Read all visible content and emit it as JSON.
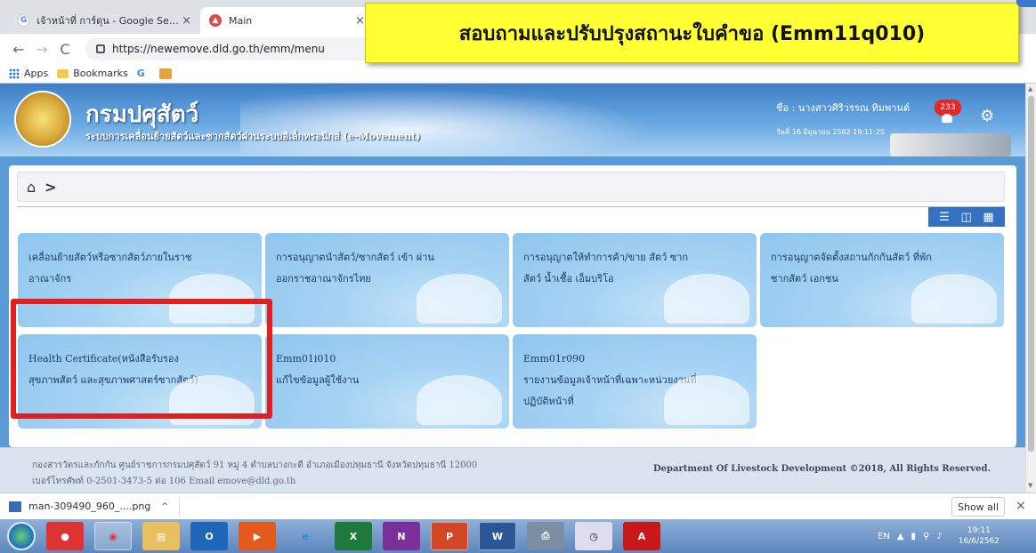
{
  "browser": {
    "tabs": [
      {
        "label": "เจ้าหน้าที่ การ์ดุน - Google Search",
        "icon": "google-icon",
        "close": "×"
      },
      {
        "label": "Main",
        "icon": "dld-favicon",
        "close": "×"
      }
    ],
    "url": "https://newemove.dld.go.th/emm/menu",
    "bookmarks": [
      {
        "label": "Apps",
        "icon": "apps-grid-icon"
      },
      {
        "label": "Bookmarks",
        "icon": "folder-icon"
      },
      {
        "label": "",
        "icon": "google-icon"
      },
      {
        "label": "",
        "icon": "image-bookmark-icon"
      }
    ]
  },
  "banner": {
    "text": "สอบถามและปรับปรุงสถานะใบคำขอ (Emm11q010)",
    "bg": "#ffff33"
  },
  "header": {
    "logo_title": "กรมปศุสัตว์",
    "logo_subtitle": "ระบบการเคลื่อนย้ายสัตว์และซากสัตว์ผ่านระบบอิเล็กทรอนิกส์ (e-Movement)",
    "user_name": "ชื่อ : นางสาวศิริวรรณ ทิมพานต์",
    "user_date": "วันที่ 16 มิถุนายน 2562 19:11:25",
    "notification_count": "233"
  },
  "breadcrumb": {
    "home_icon": "home-icon",
    "arrow": ">"
  },
  "view_toggles": [
    "list-view-icon",
    "split-view-icon",
    "grid-view-icon"
  ],
  "tiles": [
    {
      "lines": [
        "เคลื่อนย้ายสัตว์หรือซากสัตว์ภายในราช",
        "อาณาจักร"
      ],
      "icon": "truck-icon"
    },
    {
      "lines": [
        "การอนุญาตนำสัตว์/ซากสัตว์ เข้า ผ่าน",
        "ออกราชอาณาจักรไทย"
      ],
      "icon": "map-plane-ship-icon"
    },
    {
      "lines": [
        "การอนุญาตให้ทำการค้า/ขาย สัตว์ ซาก",
        "สัตว์ น้ำเชื้อ เอ็มบริโอ"
      ],
      "icon": "money-bag-icon"
    },
    {
      "lines": [
        "การอนุญาตจัดตั้งสถานกักกันสัตว์ ที่พัก",
        "ซากสัตว์ เอกชน"
      ],
      "icon": "cattle-farm-icon"
    },
    {
      "lines": [
        "Health Certificate(หนังสือรับรอง",
        "สุขภาพสัตว์ และสุขภาพศาสตร์ซากสัตว์)"
      ],
      "icon": "checklist-icon"
    },
    {
      "lines": [
        "Emm01i010",
        "แก้ไขข้อมูลผู้ใช้งาน"
      ],
      "icon": "usb-folder-icon"
    },
    {
      "lines": [
        "Emm01r090",
        "รายงานข้อมูลเจ้าหน้าที่เฉพาะหน่วยงานที่",
        "ปฏิบัติหน้าที่"
      ],
      "icon": "report-clipboard-icon"
    }
  ],
  "footer": {
    "address": "กองสารวัตรและกักกัน ศูนย์ราชการกรมปศุสัตว์ 91 หมู่ 4 ตำบลบางกะดี อำเภอเมืองปทุมธานี จังหวัดปทุมธานี 12000",
    "contact": "เบอร์โทรศัพท์ 0-2501-3473-5 ต่อ 106 Email emove@dld.go.th",
    "copyright": "Department Of Livestock Development ©2018, All Rights Reserved."
  },
  "downloads": {
    "file": "man-309490_960_....png",
    "chevron": "^",
    "show_all": "Show all",
    "close": "×"
  },
  "taskbar": {
    "apps": [
      "chrome-red-icon",
      "chrome-icon",
      "file-explorer-icon",
      "outlook-icon",
      "media-icon",
      "internet-explorer-icon",
      "excel-icon",
      "onenote-icon",
      "powerpoint-icon",
      "word-icon",
      "printer-icon",
      "clock-app-icon",
      "acrobat-icon"
    ],
    "lang": "EN",
    "time": "19:11",
    "date": "16/6/2562"
  },
  "colors": {
    "highlight": "#e02020",
    "header": "#3f7fc7",
    "tile": "#a6d3f3"
  }
}
